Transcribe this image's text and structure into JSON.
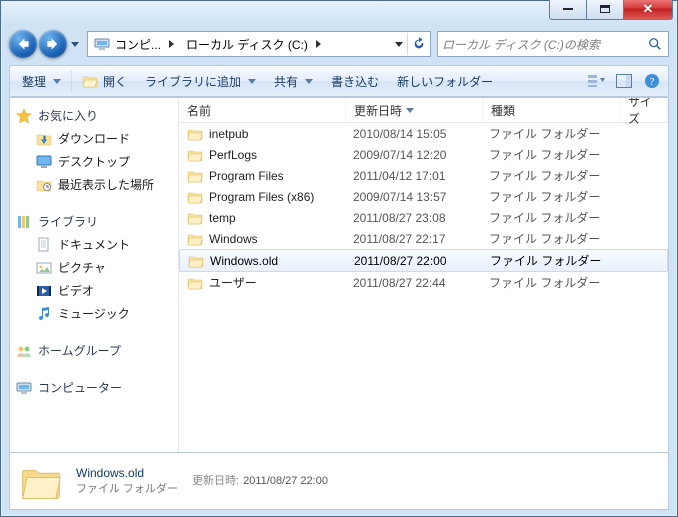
{
  "breadcrumb": {
    "root": "コンピ...",
    "drive": "ローカル ディスク (C:)"
  },
  "search": {
    "placeholder": "ローカル ディスク (C:)の検索"
  },
  "toolbar": {
    "organize": "整理",
    "open": "開く",
    "addToLibrary": "ライブラリに追加",
    "share": "共有",
    "burn": "書き込む",
    "newFolder": "新しいフォルダー"
  },
  "sidebar": {
    "favorites": {
      "label": "お気に入り",
      "items": [
        {
          "label": "ダウンロード"
        },
        {
          "label": "デスクトップ"
        },
        {
          "label": "最近表示した場所"
        }
      ]
    },
    "libraries": {
      "label": "ライブラリ",
      "items": [
        {
          "label": "ドキュメント"
        },
        {
          "label": "ピクチャ"
        },
        {
          "label": "ビデオ"
        },
        {
          "label": "ミュージック"
        }
      ]
    },
    "homegroup": {
      "label": "ホームグループ"
    },
    "computer": {
      "label": "コンピューター"
    }
  },
  "columns": {
    "name": "名前",
    "date": "更新日時",
    "type": "種類",
    "size": "サイズ"
  },
  "rows": [
    {
      "name": "inetpub",
      "date": "2010/08/14 15:05",
      "type": "ファイル フォルダー"
    },
    {
      "name": "PerfLogs",
      "date": "2009/07/14 12:20",
      "type": "ファイル フォルダー"
    },
    {
      "name": "Program Files",
      "date": "2011/04/12 17:01",
      "type": "ファイル フォルダー"
    },
    {
      "name": "Program Files (x86)",
      "date": "2009/07/14 13:57",
      "type": "ファイル フォルダー"
    },
    {
      "name": "temp",
      "date": "2011/08/27 23:08",
      "type": "ファイル フォルダー"
    },
    {
      "name": "Windows",
      "date": "2011/08/27 22:17",
      "type": "ファイル フォルダー"
    },
    {
      "name": "Windows.old",
      "date": "2011/08/27 22:00",
      "type": "ファイル フォルダー",
      "selected": true
    },
    {
      "name": "ユーザー",
      "date": "2011/08/27 22:44",
      "type": "ファイル フォルダー"
    }
  ],
  "details": {
    "name": "Windows.old",
    "type": "ファイル フォルダー",
    "dateLabel": "更新日時:",
    "date": "2011/08/27 22:00"
  }
}
